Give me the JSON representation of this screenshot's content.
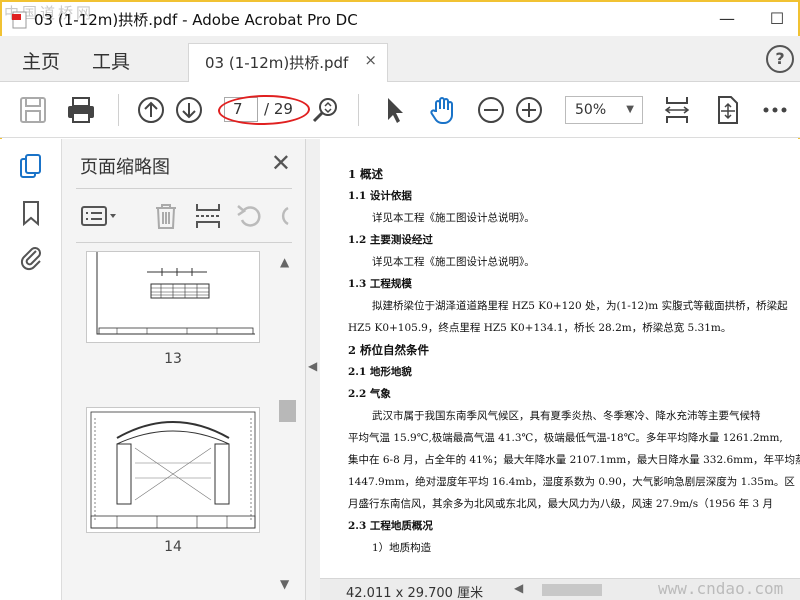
{
  "window": {
    "watermark_top": "中国道桥网",
    "title": "03 (1-12m)拱桥.pdf - Adobe Acrobat Pro DC",
    "minimize": "—",
    "maximize": "☐"
  },
  "tabs": {
    "home": "主页",
    "tools": "工具",
    "document_tab": "03 (1-12m)拱桥.pdf",
    "close": "×",
    "help": "?"
  },
  "toolbar": {
    "current_page": "7",
    "total_pages": "/ 29",
    "zoom": "50%",
    "zoom_caret": "▼",
    "highlight_color": "#e02020"
  },
  "thumbnails_panel": {
    "title": "页面缩略图",
    "close": "✕",
    "pages": [
      {
        "label": "13"
      },
      {
        "label": "14"
      }
    ],
    "scroll_up": "▲",
    "scroll_down": "▼"
  },
  "document": {
    "lines": [
      {
        "style": "h1",
        "text": "1  概述"
      },
      {
        "style": "h2",
        "text": "1.1  设计依据"
      },
      {
        "style": "p",
        "text": "详见本工程《施工图设计总说明》。"
      },
      {
        "style": "h2",
        "text": "1.2  主要测设经过"
      },
      {
        "style": "p",
        "text": "详见本工程《施工图设计总说明》。"
      },
      {
        "style": "h2",
        "text": "1.3  工程规模"
      },
      {
        "style": "p",
        "text": "拟建桥梁位于湖泽道道路里程 HZ5 K0+120 处，为(1-12)m 实腹式等截面拱桥，桥梁起"
      },
      {
        "style": "pc",
        "text": "HZ5 K0+105.9，终点里程 HZ5 K0+134.1，桥长 28.2m，桥梁总宽 5.31m。"
      },
      {
        "style": "h1",
        "text": "2  桥位自然条件"
      },
      {
        "style": "h2",
        "text": "2.1  地形地貌"
      },
      {
        "style": "h2",
        "text": "2.2  气象"
      },
      {
        "style": "p",
        "text": "武汉市属于我国东南季风气候区，具有夏季炎热、冬季寒冷、降水充沛等主要气候特"
      },
      {
        "style": "pc",
        "text": "平均气温 15.9℃,极端最高气温 41.3℃，极端最低气温-18℃。多年平均降水量 1261.2mm,"
      },
      {
        "style": "pc",
        "text": "集中在 6-8 月，占全年的 41%；最大年降水量 2107.1mm，最大日降水量 332.6mm，年平均蒸"
      },
      {
        "style": "pc",
        "text": "1447.9mm，绝对湿度年平均 16.4mb，湿度系数为 0.90，大气影响急剧层深度为 1.35m。区"
      },
      {
        "style": "pc",
        "text": "月盛行东南信风，其余多为北风或东北风，最大风力为八级，风速 27.9m/s（1956 年 3 月"
      },
      {
        "style": "h2",
        "text": "2.3  工程地质概况"
      },
      {
        "style": "p",
        "text": "1）地质构造"
      }
    ]
  },
  "status_bar": {
    "dimensions": "42.011 x 29.700 厘米",
    "scroll_left": "◀",
    "watermark": "www.cndao.com"
  },
  "colors": {
    "frame": "#f1c232",
    "accent_blue": "#1a73c8"
  }
}
